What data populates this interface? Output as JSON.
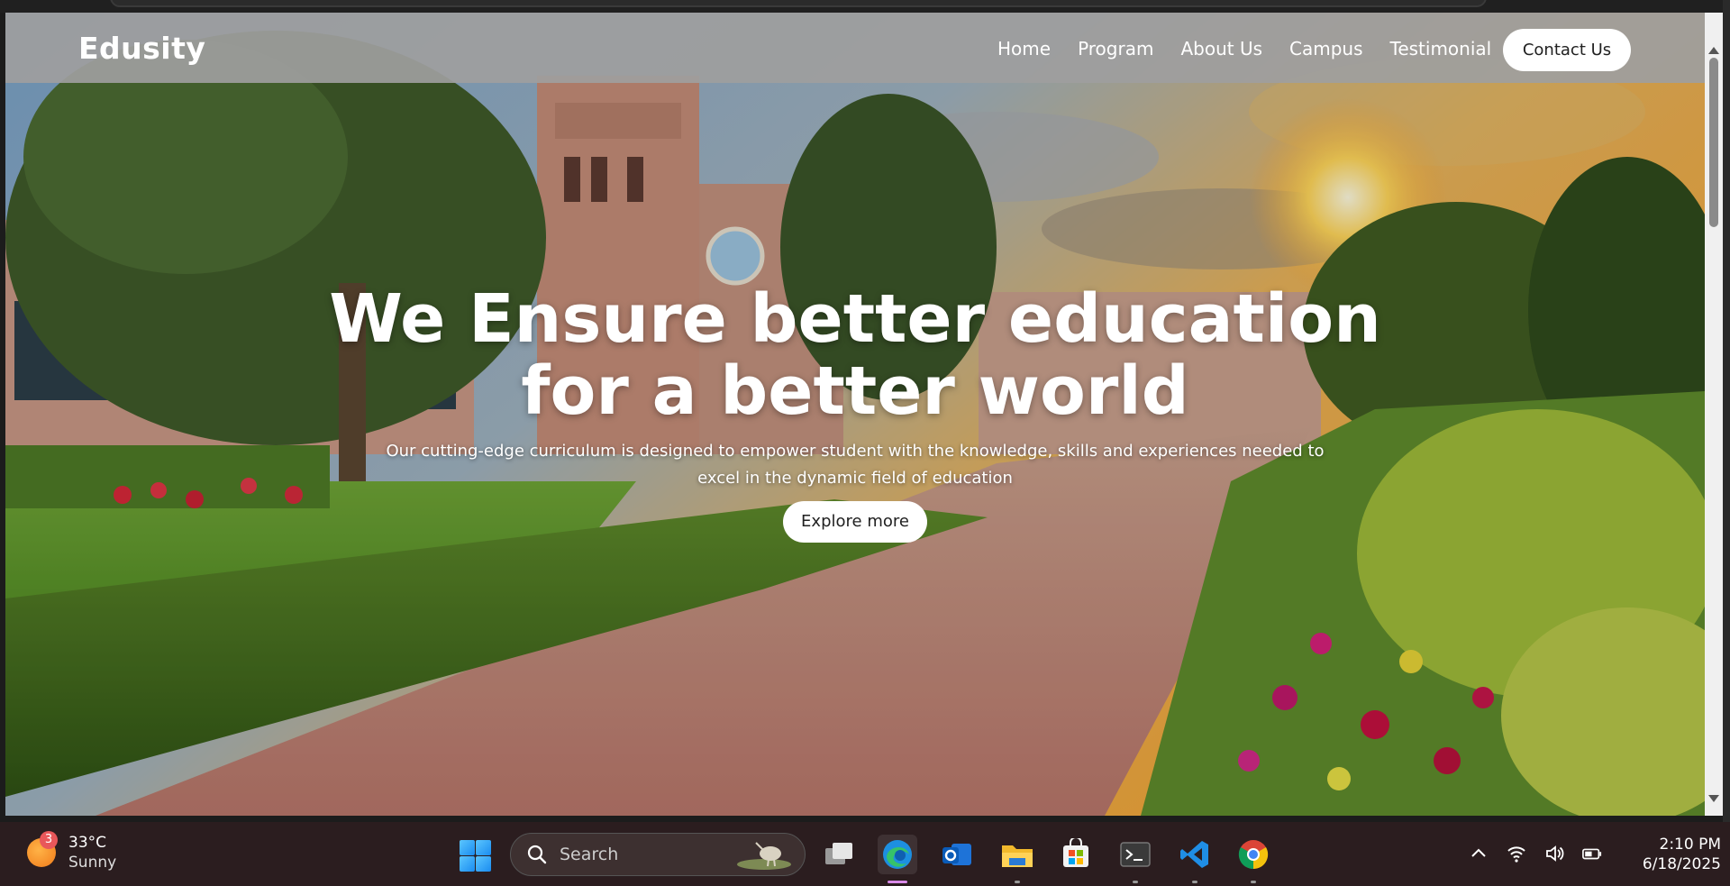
{
  "site": {
    "logo": "Edusity",
    "nav": [
      {
        "label": "Home"
      },
      {
        "label": "Program"
      },
      {
        "label": "About Us"
      },
      {
        "label": "Campus"
      },
      {
        "label": "Testimonial"
      }
    ],
    "contact_label": "Contact Us"
  },
  "hero": {
    "title_line1": "We Ensure better education",
    "title_line2": "for a better world",
    "subtitle": "Our cutting-edge curriculum is designed to empower student with the knowledge, skills and experiences needed to excel in the dynamic field of education",
    "cta_label": "Explore more"
  },
  "taskbar": {
    "weather": {
      "temp": "33°C",
      "condition": "Sunny",
      "badge": "3",
      "icon": "sun-icon"
    },
    "search_label": "Search",
    "apps": [
      {
        "name": "task-view",
        "icon": "task-view-icon"
      },
      {
        "name": "edge",
        "icon": "edge-icon",
        "active": true
      },
      {
        "name": "outlook",
        "icon": "outlook-icon"
      },
      {
        "name": "file-explorer",
        "icon": "folder-icon"
      },
      {
        "name": "microsoft-store",
        "icon": "store-icon"
      },
      {
        "name": "terminal",
        "icon": "terminal-icon"
      },
      {
        "name": "vscode",
        "icon": "vscode-icon"
      },
      {
        "name": "chrome",
        "icon": "chrome-icon"
      }
    ],
    "tray": [
      "chevron-up-icon",
      "wifi-icon",
      "volume-icon",
      "battery-icon"
    ],
    "time": "2:10 PM",
    "date": "6/18/2025"
  },
  "colors": {
    "navbar": "#9e9e9e",
    "taskbar": "#2b1d1f",
    "accent": "#ffffff"
  }
}
